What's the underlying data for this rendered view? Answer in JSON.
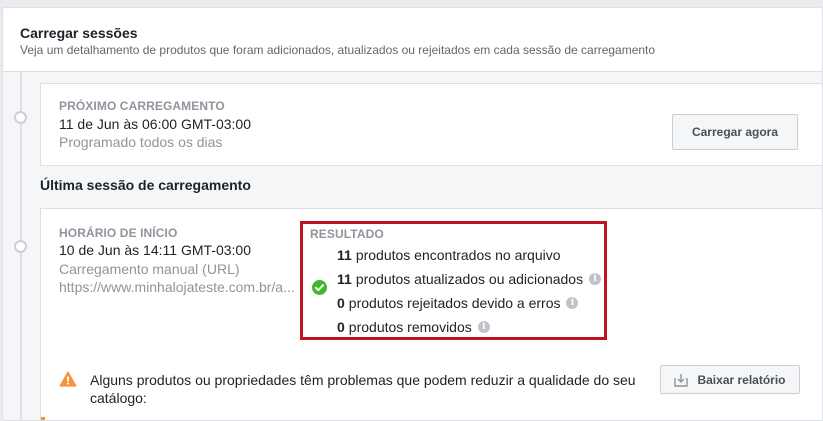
{
  "header": {
    "title": "Carregar sessões",
    "subtitle": "Veja um detalhamento de produtos que foram adicionados, atualizados ou rejeitados em cada sessão de carregamento"
  },
  "next_upload": {
    "label": "PRÓXIMO CARREGAMENTO",
    "datetime": "11 de Jun às 06:00 GMT-03:00",
    "schedule": "Programado todos os dias",
    "button_label": "Carregar agora"
  },
  "last_session": {
    "heading": "Última sessão de carregamento",
    "start_label": "HORÁRIO DE INÍCIO",
    "start_datetime": "10 de Jun às 14:11 GMT-03:00",
    "method": "Carregamento manual (URL)",
    "url": "https://www.minhalojateste.com.br/a...",
    "result": {
      "label": "RESULTADO",
      "rows": [
        {
          "count": "11",
          "text": "produtos encontrados no arquivo",
          "icon": "none"
        },
        {
          "count": "11",
          "text": "produtos atualizados ou adicionados",
          "icon": "info-icon",
          "status_icon": "check-icon",
          "status_color": "#42b72a"
        },
        {
          "count": "0",
          "text": "produtos rejeitados devido a erros",
          "icon": "info-icon"
        },
        {
          "count": "0",
          "text": "produtos removidos",
          "icon": "info-icon"
        }
      ],
      "highlight_color": "#c1121f"
    },
    "warning": {
      "icon": "warning-triangle-icon",
      "color": "#f7923b",
      "text": "Alguns produtos ou propriedades têm problemas que podem reduzir a qualidade do seu catálogo:"
    },
    "report_button_label": "Baixar relatório"
  }
}
